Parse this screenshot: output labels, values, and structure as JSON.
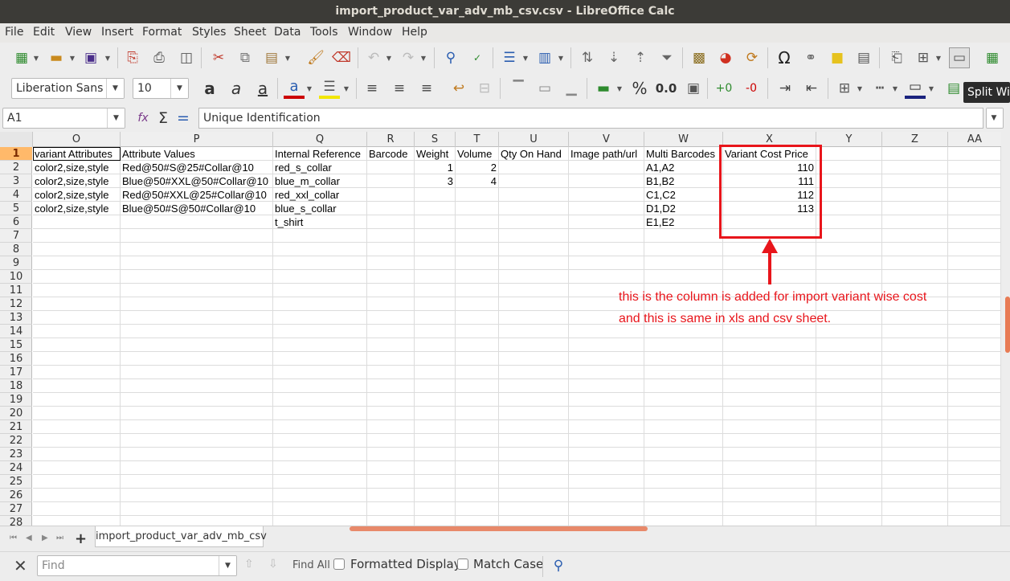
{
  "window": {
    "title": "import_product_var_adv_mb_csv.csv - LibreOffice Calc"
  },
  "menu": [
    "File",
    "Edit",
    "View",
    "Insert",
    "Format",
    "Styles",
    "Sheet",
    "Data",
    "Tools",
    "Window",
    "Help"
  ],
  "toolbar": {
    "font_name": "Liberation Sans",
    "font_size": "10",
    "percent_label": "%",
    "decimal_label": "0.0",
    "tooltip": "Split Wi"
  },
  "formula_bar": {
    "name_box": "A1",
    "content": "Unique Identification"
  },
  "columns": [
    "O",
    "P",
    "Q",
    "R",
    "S",
    "T",
    "U",
    "V",
    "W",
    "X",
    "Y",
    "Z",
    "AA"
  ],
  "rows": [
    "1",
    "2",
    "3",
    "4",
    "5",
    "6",
    "7",
    "8",
    "9",
    "10",
    "11",
    "12",
    "13",
    "14",
    "15",
    "16",
    "17",
    "18",
    "19",
    "20",
    "21",
    "22",
    "23",
    "24",
    "25",
    "26",
    "27",
    "28"
  ],
  "cells": [
    [
      "variant Attributes",
      "Attribute Values",
      "Internal Reference",
      "Barcode",
      "Weight",
      "Volume",
      "Qty On Hand",
      "Image path/url",
      "Multi Barcodes",
      "Variant Cost Price"
    ],
    [
      "color2,size,style",
      "Red@50#S@25#Collar@10",
      "red_s_collar",
      "",
      "1",
      "2",
      "",
      "",
      "A1,A2",
      "110"
    ],
    [
      "color2,size,style",
      "Blue@50#XXL@50#Collar@10",
      "blue_m_collar",
      "",
      "3",
      "4",
      "",
      "",
      "B1,B2",
      "111"
    ],
    [
      "color2,size,style",
      "Red@50#XXL@25#Collar@10",
      "red_xxl_collar",
      "",
      "",
      "",
      "",
      "",
      "C1,C2",
      "112"
    ],
    [
      "color2,size,style",
      "Blue@50#S@50#Collar@10",
      "blue_s_collar",
      "",
      "",
      "",
      "",
      "",
      "D1,D2",
      "113"
    ],
    [
      "",
      "",
      "t_shirt",
      "",
      "",
      "",
      "",
      "",
      "E1,E2",
      ""
    ]
  ],
  "annotation": {
    "line1": "this is the column is added for import variant wise cost",
    "line2": "and this is same in xls and csv sheet.",
    "color": "#e8151b"
  },
  "sheet_tab": "import_product_var_adv_mb_csv",
  "find_bar": {
    "placeholder": "Find",
    "find_all": "Find All",
    "formatted_display": "Formatted Display",
    "match_case": "Match Case"
  }
}
